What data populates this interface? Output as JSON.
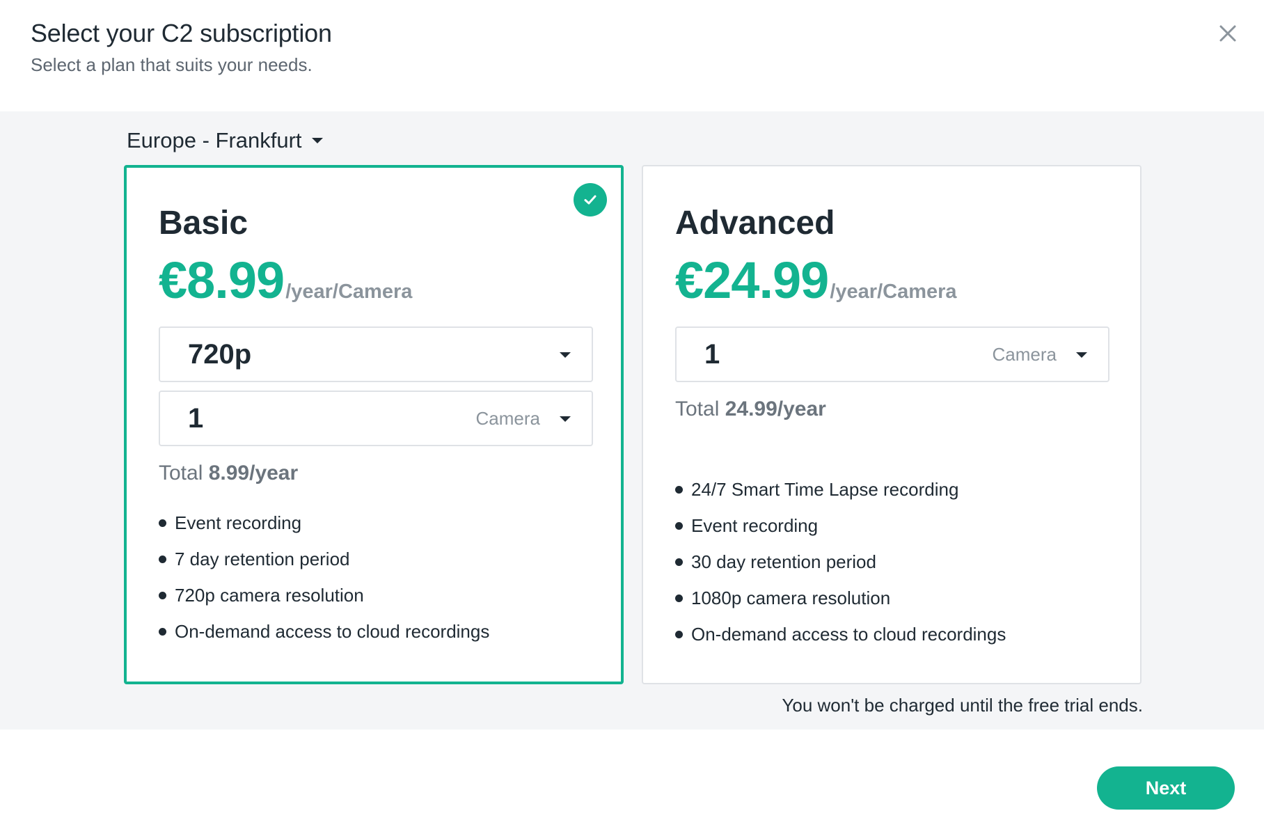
{
  "header": {
    "title": "Select your C2 subscription",
    "subtitle": "Select a plan that suits your needs."
  },
  "region": {
    "selected": "Europe - Frankfurt"
  },
  "plans": [
    {
      "name": "Basic",
      "selected": true,
      "price": "€8.99",
      "per": "/year/Camera",
      "resolution": "720p",
      "camera_count": "1",
      "camera_unit": "Camera",
      "total_label": "Total",
      "total_value": "8.99/year",
      "features": [
        "Event recording",
        "7 day retention period",
        "720p camera resolution",
        "On-demand access to cloud recordings"
      ]
    },
    {
      "name": "Advanced",
      "selected": false,
      "price": "€24.99",
      "per": "/year/Camera",
      "camera_count": "1",
      "camera_unit": "Camera",
      "total_label": "Total",
      "total_value": "24.99/year",
      "features": [
        "24/7 Smart Time Lapse recording",
        "Event recording",
        "30 day retention period",
        "1080p camera resolution",
        "On-demand access to cloud recordings"
      ]
    }
  ],
  "note": "You won't be charged until the free trial ends.",
  "actions": {
    "next_label": "Next"
  },
  "colors": {
    "accent": "#13b390",
    "text": "#1f2a33",
    "muted": "#8b949c",
    "band": "#f4f5f7"
  },
  "icons": {
    "close": "close-icon",
    "check": "check-icon",
    "dropdown": "chevron-down-icon"
  }
}
